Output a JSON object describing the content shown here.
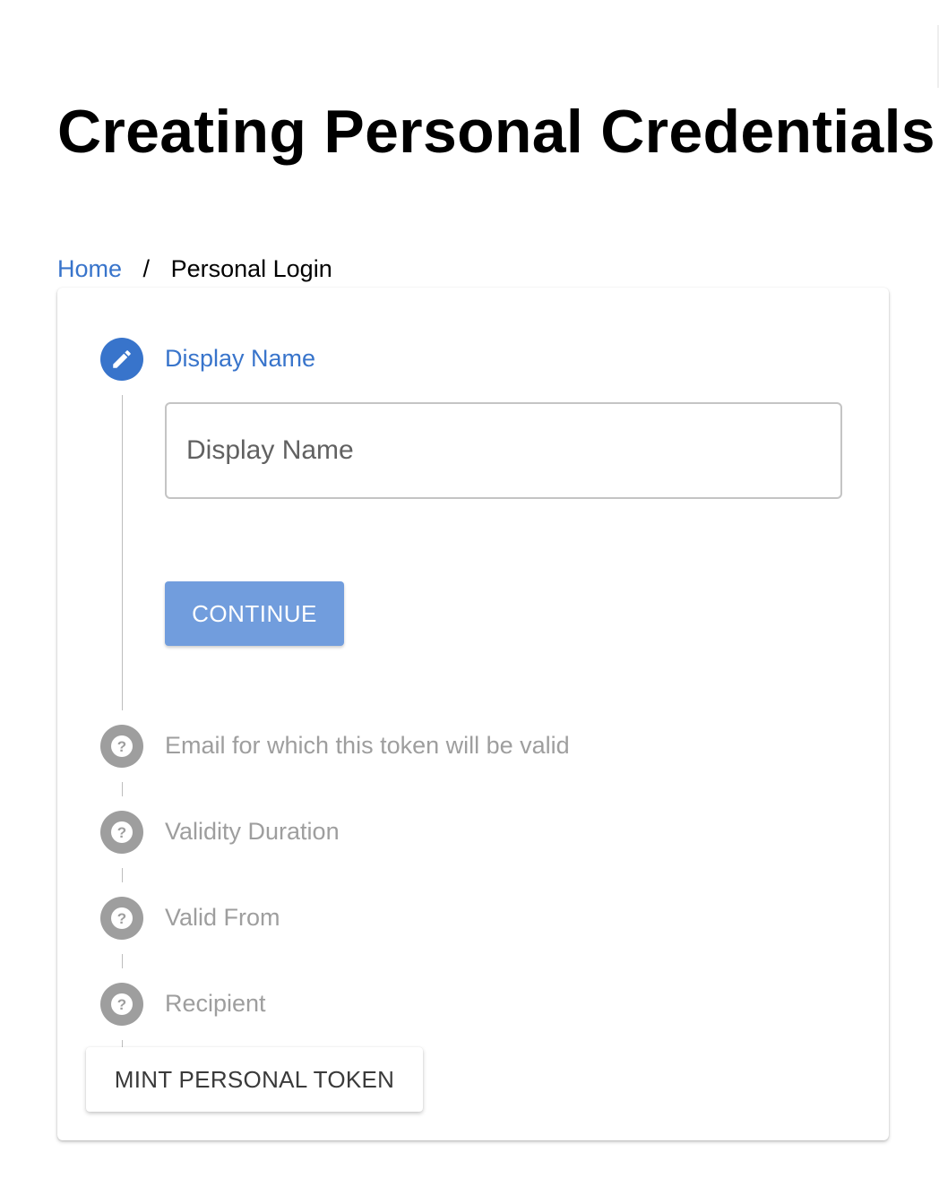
{
  "page": {
    "title": "Creating Personal Credentials"
  },
  "breadcrumb": {
    "home": "Home",
    "separator": "/",
    "current": "Personal Login"
  },
  "stepper": {
    "active_color": "#3874cb",
    "pending_color": "#9e9e9e",
    "steps": [
      {
        "label": "Display Name",
        "state": "active",
        "icon": "pencil-icon"
      },
      {
        "label": "Email for which this token will be valid",
        "state": "pending",
        "icon": "question-icon"
      },
      {
        "label": "Validity Duration",
        "state": "pending",
        "icon": "question-icon"
      },
      {
        "label": "Valid From",
        "state": "pending",
        "icon": "question-icon"
      },
      {
        "label": "Recipient",
        "state": "pending",
        "icon": "question-icon"
      }
    ],
    "display_name_field": {
      "value": "",
      "placeholder": "Display Name"
    },
    "continue_label": "CONTINUE",
    "continue_color": "#719ddd"
  },
  "actions": {
    "mint_label": "MINT PERSONAL TOKEN"
  }
}
